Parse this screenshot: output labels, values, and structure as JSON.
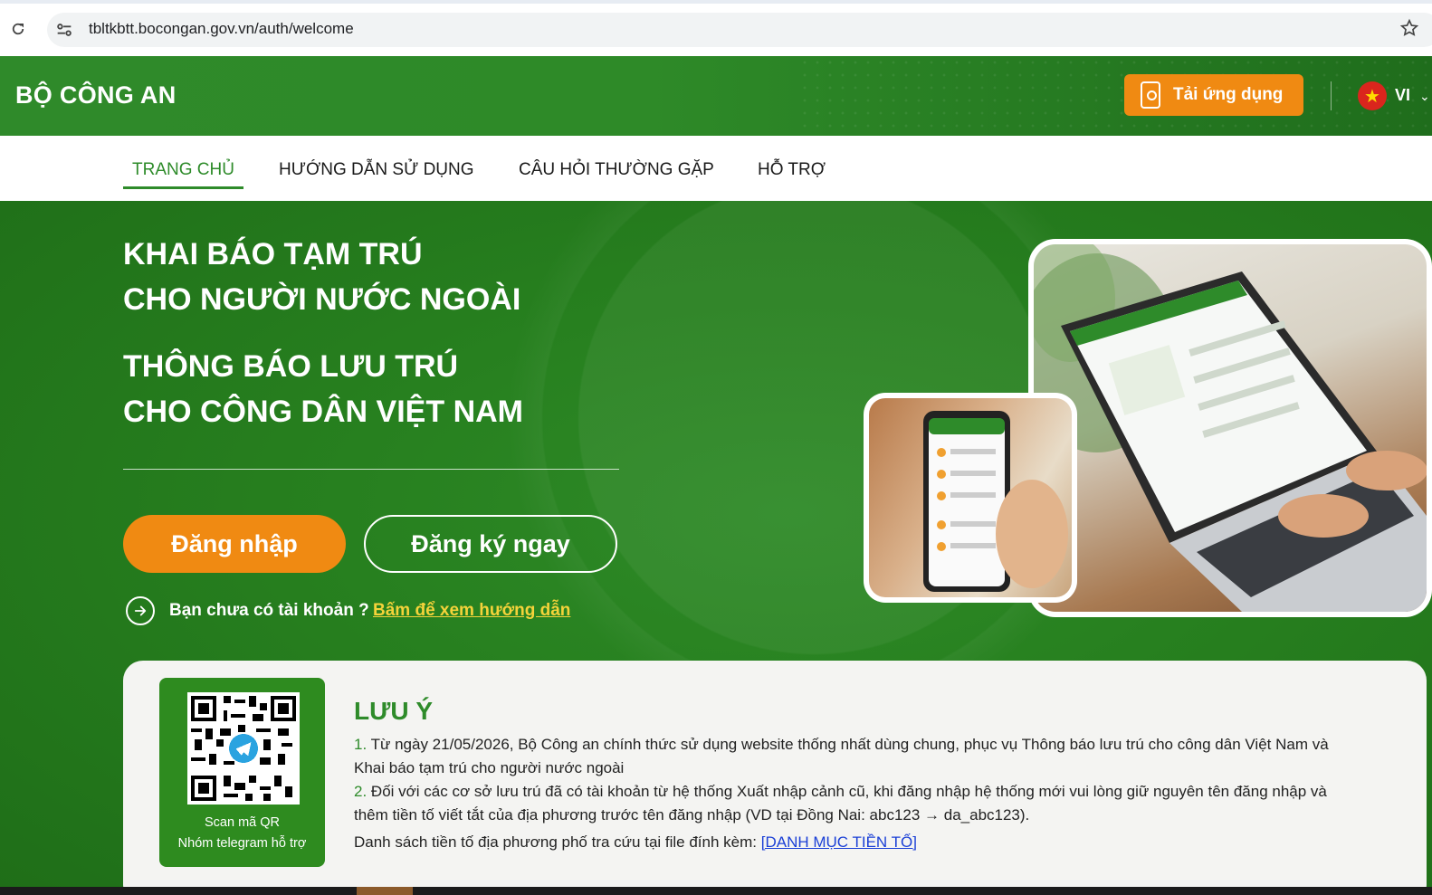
{
  "browser": {
    "url": "tbltkbtt.bocongan.gov.vn/auth/welcome"
  },
  "header": {
    "brand": "BỘ CÔNG AN",
    "app_button": "Tải ứng dụng",
    "language": "VI"
  },
  "nav": {
    "items": [
      {
        "label": "TRANG CHỦ",
        "active": true
      },
      {
        "label": "HƯỚNG DẪN SỬ DỤNG",
        "active": false
      },
      {
        "label": "CÂU HỎI THƯỜNG GẶP",
        "active": false
      },
      {
        "label": "HỖ TRỢ",
        "active": false
      }
    ]
  },
  "hero": {
    "title_lines": [
      "KHAI BÁO TẠM TRÚ",
      "CHO NGƯỜI NƯỚC NGOÀI",
      "THÔNG BÁO LƯU TRÚ",
      "CHO CÔNG DÂN VIỆT NAM"
    ],
    "login_button": "Đăng nhập",
    "register_button": "Đăng ký ngay",
    "guide_text": "Bạn chưa có tài khoản ?",
    "guide_link": "Bấm để xem hướng dẫn"
  },
  "notice": {
    "qr_caption_1": "Scan mã QR",
    "qr_caption_2": "Nhóm telegram hỗ trợ",
    "title": "LƯU Ý",
    "item1_num": "1.",
    "item1_text": "Từ ngày 21/05/2026, Bộ Công an chính thức sử dụng website thống nhất dùng chung, phục vụ Thông báo lưu trú cho công dân Việt Nam và",
    "item1_text_cont": "Khai báo tạm trú cho người nước ngoài",
    "item2_num": "2.",
    "item2_text": "Đối với các cơ sở lưu trú đã có tài khoản từ hệ thống Xuất nhập cảnh cũ, khi đăng nhập hệ thống mới vui lòng giữ nguyên tên đăng nhập và",
    "item2_text_cont": "thêm tiền tố viết tắt của địa phương trước tên đăng nhập (VD tại Đồng Nai: abc123 → da_abc123).",
    "lookup_text": "Danh sách tiền tố địa phương phố tra cứu tại file đính kèm:",
    "lookup_link": "[DANH MỤC TIỀN TỐ]"
  },
  "colors": {
    "brand_green": "#2e8b2a",
    "accent_orange": "#f08a12",
    "link_yellow": "#f5d33a",
    "link_blue": "#1a3fd6"
  },
  "icons": [
    "reload-icon",
    "site-info-icon",
    "bookmark-star-icon",
    "phone-app-icon",
    "vietnam-flag-icon",
    "chevron-down-icon",
    "arrow-circle-right-icon",
    "telegram-icon",
    "qr-code"
  ]
}
